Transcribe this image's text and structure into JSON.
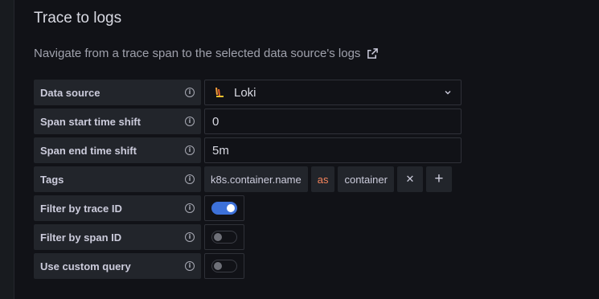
{
  "section": {
    "title": "Trace to logs",
    "description": "Navigate from a trace span to the selected data source's logs"
  },
  "rows": {
    "data_source": {
      "label": "Data source",
      "value": "Loki",
      "icon": "loki-logo"
    },
    "span_start": {
      "label": "Span start time shift",
      "value": "0"
    },
    "span_end": {
      "label": "Span end time shift",
      "value": "5m"
    },
    "tags": {
      "label": "Tags",
      "key": "k8s.container.name",
      "as_label": "as",
      "alias": "container",
      "remove_symbol": "✕",
      "add_symbol": "+"
    },
    "filter_trace": {
      "label": "Filter by trace ID",
      "enabled": true
    },
    "filter_span": {
      "label": "Filter by span ID",
      "enabled": false
    },
    "custom_query": {
      "label": "Use custom query",
      "enabled": false
    }
  },
  "colors": {
    "background": "#111217",
    "label_bg": "#22252b",
    "accent_blue": "#3d71d9",
    "as_orange": "#f5845c"
  }
}
